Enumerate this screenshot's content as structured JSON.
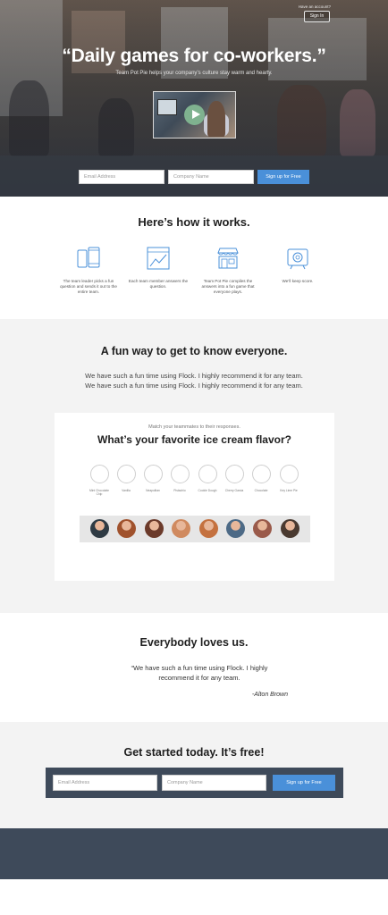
{
  "header": {
    "account_prompt": "Have an account?",
    "signin_label": "Sign In"
  },
  "hero": {
    "title": "“Daily games for co-workers.”",
    "subtitle": "Team Pot Pie helps your company’s culture stay warm and hearty.",
    "email_placeholder": "Email Address",
    "company_placeholder": "Company Name",
    "signup_label": "Sign up for Free"
  },
  "how": {
    "title": "Here’s how it works.",
    "steps": [
      {
        "icon": "phones-icon",
        "text": "The team leader picks a fun question and sends it out to the entire team."
      },
      {
        "icon": "chart-icon",
        "text": "Each team member answers the question."
      },
      {
        "icon": "storefront-icon",
        "text": "Team Pot Pie compiles the answers into a fun game that everyone plays."
      },
      {
        "icon": "score-icon",
        "text": "We’ll keep score."
      }
    ]
  },
  "fun": {
    "title": "A fun way to get to know everyone.",
    "text_line1": "We have such a fun time using Flock. I highly  recommend it for any team.",
    "text_line2": "We have such a fun time using Flock. I highly  recommend it for any team.",
    "game": {
      "instruction": "Match your teammates to their responses.",
      "question": "What’s your favorite ice cream flavor?",
      "choices": [
        "Mint Chocolate Chip",
        "Vanilla",
        "Neapolitan",
        "Pistachio",
        "Cookie Dough",
        "Cherry Garcia",
        "Chocolate",
        "Key Lime Pie"
      ],
      "avatar_colors": [
        "#2f3b44",
        "#a0522d",
        "#6b3a2a",
        "#d08a5f",
        "#c4713f",
        "#4d6a86",
        "#9a5a4a",
        "#4a3a30"
      ]
    }
  },
  "loves": {
    "title": "Everybody loves us.",
    "quote": "“We have such a fun time using Flock. I highly recommend it for any team.",
    "author": "-Alton Brown"
  },
  "started": {
    "title": "Get started today. It’s free!",
    "email_placeholder": "Email Address",
    "company_placeholder": "Company Name",
    "signup_label": "Sign up for Free"
  },
  "colors": {
    "accent": "#4a90d9",
    "dark_band": "#3e4a5a",
    "light_section": "#f3f3f3"
  }
}
